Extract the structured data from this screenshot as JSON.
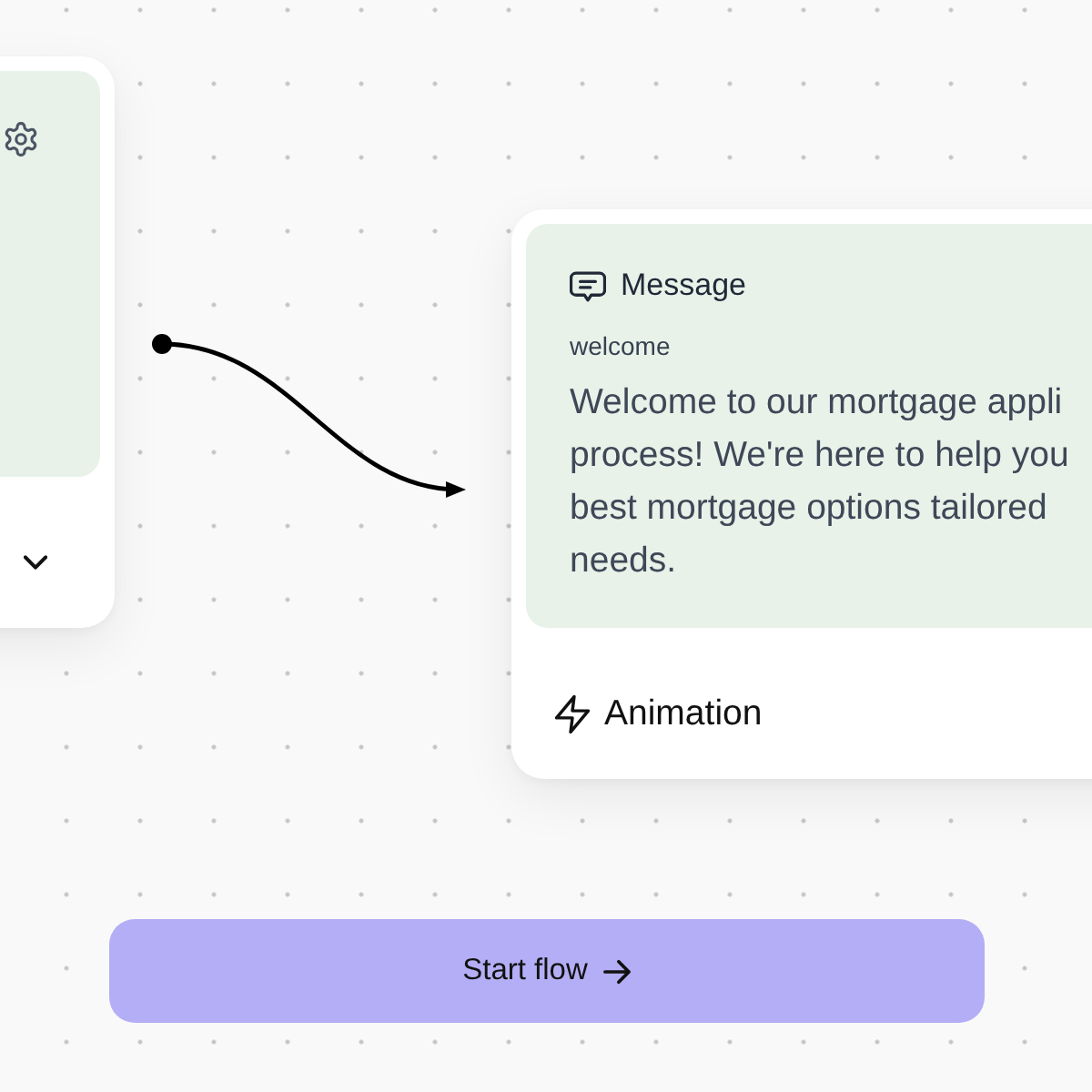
{
  "nodes": [
    {
      "kind": "blank"
    },
    {
      "kind": "message",
      "title": "Message",
      "name": "welcome",
      "lines": [
        "Welcome to our mortgage appli",
        "process! We're here to help you",
        "best mortgage options tailored",
        "needs."
      ],
      "action": "Animation"
    }
  ],
  "start_button": {
    "label": "Start flow"
  }
}
